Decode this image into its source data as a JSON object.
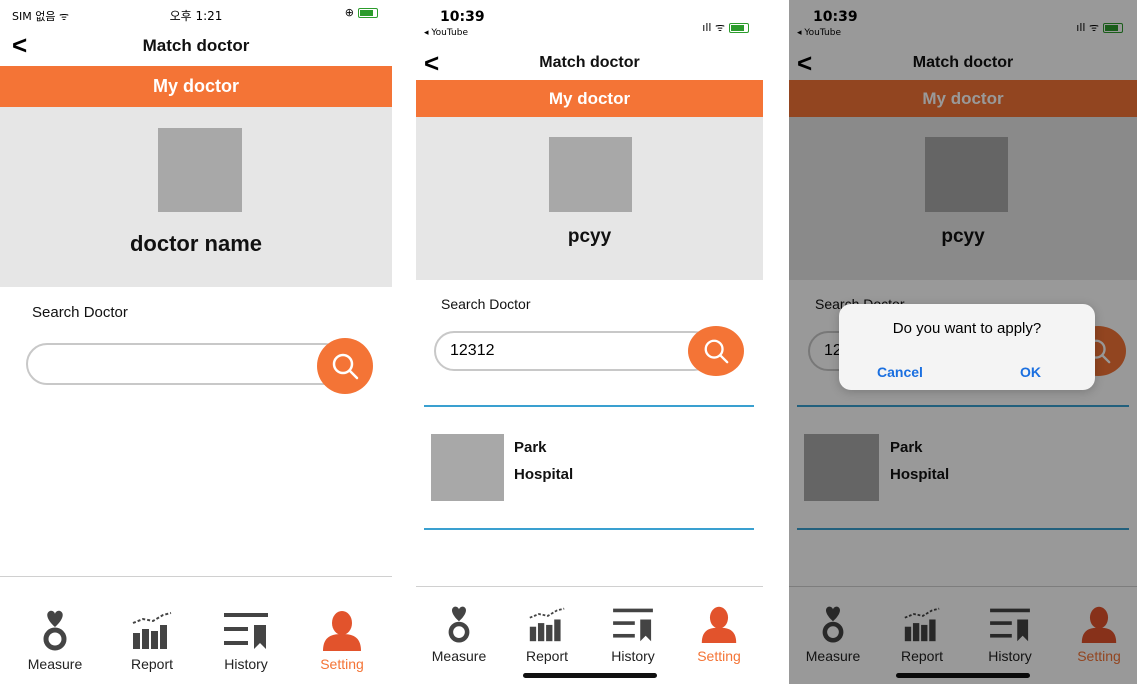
{
  "screens": [
    {
      "status": {
        "carrier": "SIM 없음 ᯤ",
        "time": "오후 1:21",
        "right": "⊕"
      },
      "nav": {
        "title": "Match doctor",
        "back": "<"
      },
      "banner": "My doctor",
      "doctor": {
        "name": "doctor name"
      },
      "search": {
        "label": "Search Doctor",
        "value": ""
      },
      "tabs": [
        "Measure",
        "Report",
        "History",
        "Setting"
      ]
    },
    {
      "status": {
        "time": "10:39",
        "back_app": "◂ YouTube",
        "signal": "ıll ᯤ"
      },
      "nav": {
        "title": "Match doctor",
        "back": "<"
      },
      "banner": "My doctor",
      "doctor": {
        "name": "pcyy"
      },
      "search": {
        "label": "Search Doctor",
        "value": "12312"
      },
      "result": {
        "name": "Park",
        "hospital": "Hospital"
      },
      "tabs": [
        "Measure",
        "Report",
        "History",
        "Setting"
      ]
    },
    {
      "status": {
        "time": "10:39",
        "back_app": "◂ YouTube",
        "signal": "ıll ᯤ"
      },
      "nav": {
        "title": "Match doctor",
        "back": "<"
      },
      "banner": "My doctor",
      "doctor": {
        "name": "pcyy"
      },
      "search": {
        "label": "Search Doctor",
        "value": "12312"
      },
      "result": {
        "name": "Park",
        "hospital": "Hospital"
      },
      "tabs": [
        "Measure",
        "Report",
        "History",
        "Setting"
      ],
      "dialog": {
        "message": "Do you want to apply?",
        "cancel": "Cancel",
        "ok": "OK"
      }
    }
  ],
  "colors": {
    "accent": "#f47436",
    "divider": "#3aa0d0",
    "panel": "#e6e6e6",
    "placeholder": "#a8a8a8",
    "link": "#1a6fe0"
  },
  "icons": [
    "heart-ring-icon",
    "bar-chart-icon",
    "history-list-icon",
    "person-icon",
    "search-icon",
    "back-chevron-icon"
  ]
}
